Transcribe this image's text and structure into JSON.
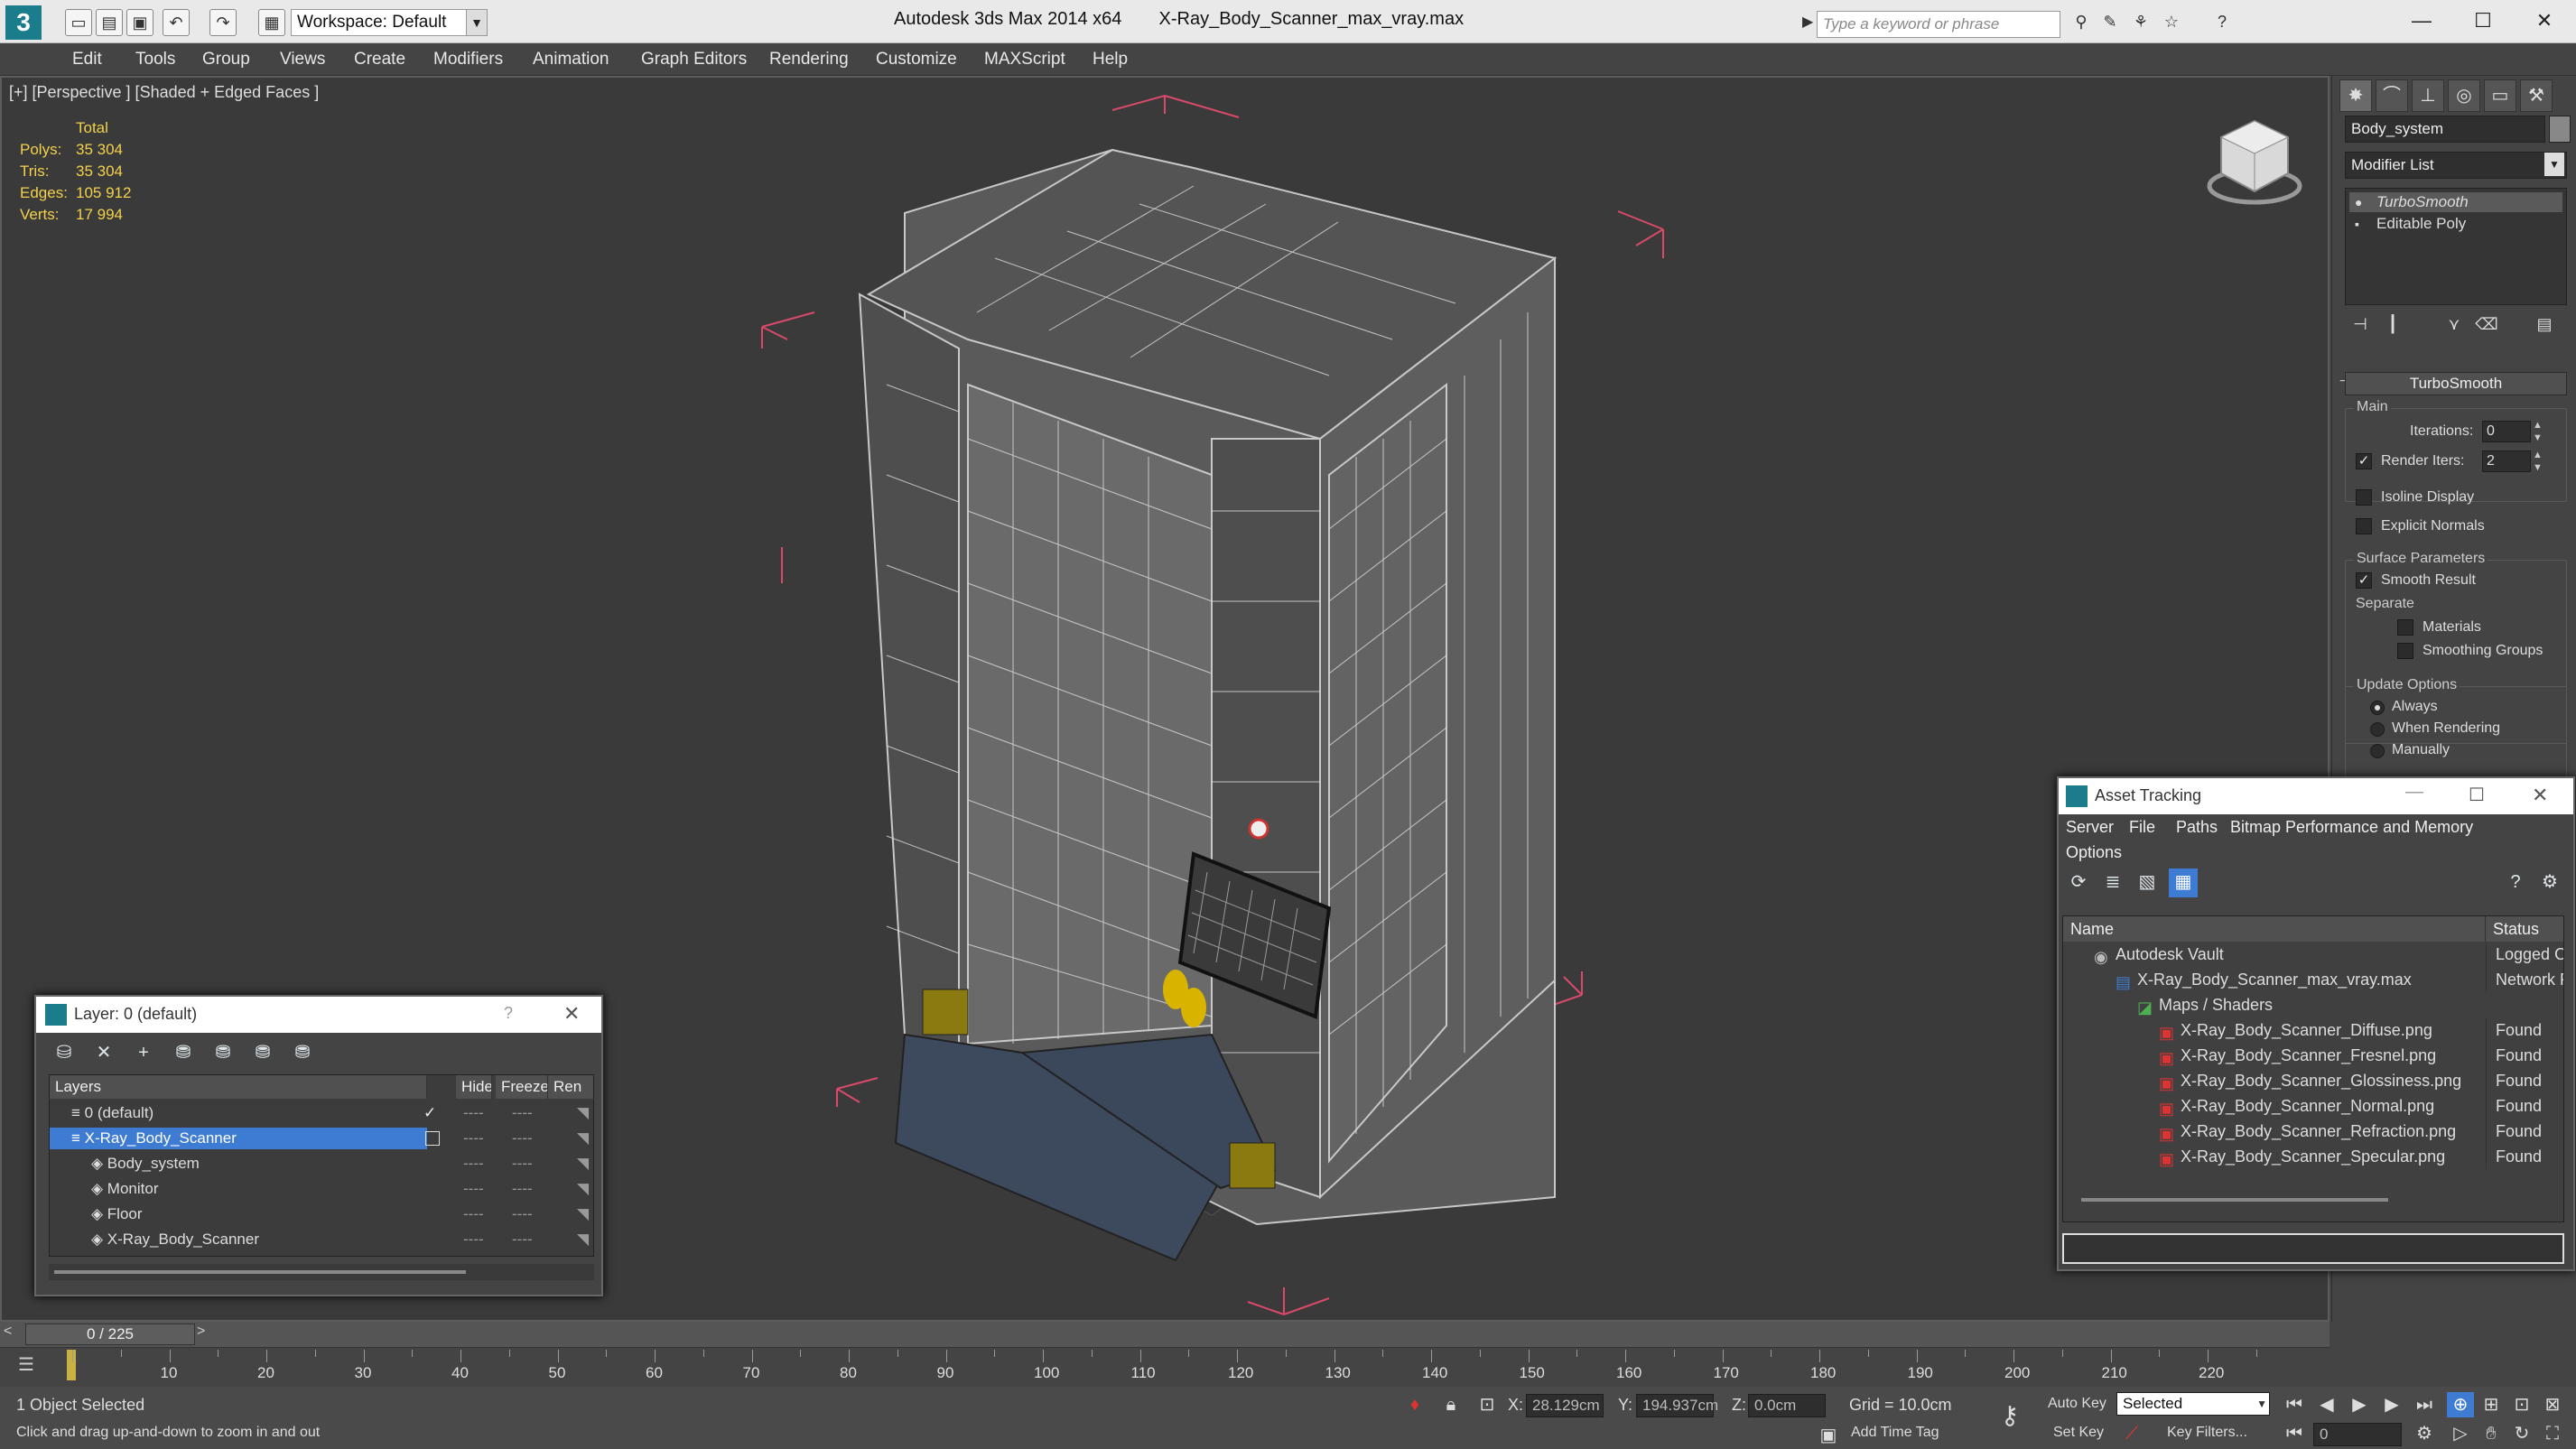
{
  "app": {
    "title": "Autodesk 3ds Max  2014 x64",
    "filename": "X-Ray_Body_Scanner_max_vray.max",
    "workspace": "Workspace: Default",
    "search_placeholder": "Type a keyword or phrase"
  },
  "menu": [
    "Edit",
    "Tools",
    "Group",
    "Views",
    "Create",
    "Modifiers",
    "Animation",
    "Graph Editors",
    "Rendering",
    "Customize",
    "MAXScript",
    "Help"
  ],
  "viewport": {
    "label": "[+] [Perspective ] [Shaded + Edged Faces ]",
    "stats": {
      "header": "Total",
      "rows": [
        {
          "label": "Polys:",
          "value": "35 304"
        },
        {
          "label": "Tris:",
          "value": "35 304"
        },
        {
          "label": "Edges:",
          "value": "105 912"
        },
        {
          "label": "Verts:",
          "value": "17 994"
        }
      ]
    }
  },
  "command_panel": {
    "object_name": "Body_system",
    "modifier_list": "Modifier List",
    "stack": [
      "TurboSmooth",
      "Editable Poly"
    ],
    "rollout": "TurboSmooth",
    "main_group": "Main",
    "iterations_label": "Iterations:",
    "iterations_value": "0",
    "render_iters_label": "Render Iters:",
    "render_iters_value": "2",
    "isoline_display": "Isoline Display",
    "explicit_normals": "Explicit Normals",
    "surface_params": "Surface Parameters",
    "smooth_result": "Smooth Result",
    "separate": "Separate",
    "materials": "Materials",
    "smoothing_groups": "Smoothing Groups",
    "update_options": "Update Options",
    "always": "Always",
    "when_rendering": "When Rendering",
    "manually": "Manually"
  },
  "layer_window": {
    "title": "Layer: 0 (default)",
    "help": "?",
    "columns": [
      "Layers",
      "Hide",
      "Freeze",
      "Ren"
    ],
    "rows": [
      {
        "name": "0 (default)",
        "indent": 1,
        "selected": false,
        "icon": "layer-stack-icon"
      },
      {
        "name": "X-Ray_Body_Scanner",
        "indent": 1,
        "selected": true,
        "icon": "layer-stack-icon"
      },
      {
        "name": "Body_system",
        "indent": 2,
        "selected": false,
        "icon": "object-icon"
      },
      {
        "name": "Monitor",
        "indent": 2,
        "selected": false,
        "icon": "object-icon"
      },
      {
        "name": "Floor",
        "indent": 2,
        "selected": false,
        "icon": "object-icon"
      },
      {
        "name": "X-Ray_Body_Scanner",
        "indent": 2,
        "selected": false,
        "icon": "object-icon"
      }
    ],
    "dash": "----"
  },
  "asset_window": {
    "title": "Asset Tracking",
    "menu": [
      "Server",
      "File",
      "Paths",
      "Bitmap Performance and Memory",
      "Options"
    ],
    "columns": [
      "Name",
      "Status"
    ],
    "rows": [
      {
        "name": "Autodesk Vault",
        "status": "Logged O",
        "indent": 1,
        "icon": "vault-icon"
      },
      {
        "name": "X-Ray_Body_Scanner_max_vray.max",
        "status": "Network F",
        "indent": 2,
        "icon": "max-file-icon"
      },
      {
        "name": "Maps / Shaders",
        "status": "",
        "indent": 3,
        "icon": "maps-icon"
      },
      {
        "name": "X-Ray_Body_Scanner_Diffuse.png",
        "status": "Found",
        "indent": 4,
        "icon": "png-icon"
      },
      {
        "name": "X-Ray_Body_Scanner_Fresnel.png",
        "status": "Found",
        "indent": 4,
        "icon": "png-icon"
      },
      {
        "name": "X-Ray_Body_Scanner_Glossiness.png",
        "status": "Found",
        "indent": 4,
        "icon": "png-icon"
      },
      {
        "name": "X-Ray_Body_Scanner_Normal.png",
        "status": "Found",
        "indent": 4,
        "icon": "png-icon"
      },
      {
        "name": "X-Ray_Body_Scanner_Refraction.png",
        "status": "Found",
        "indent": 4,
        "icon": "png-icon"
      },
      {
        "name": "X-Ray_Body_Scanner_Specular.png",
        "status": "Found",
        "indent": 4,
        "icon": "png-icon"
      }
    ]
  },
  "timeline": {
    "frame_display": "0 / 225",
    "ticks": [
      "10",
      "20",
      "30",
      "40",
      "50",
      "60",
      "70",
      "80",
      "90",
      "100",
      "110",
      "120",
      "130",
      "140",
      "150",
      "160",
      "170",
      "180",
      "190",
      "200",
      "210",
      "220"
    ]
  },
  "status": {
    "selection": "1 Object Selected",
    "prompt": "Click and drag up-and-down to zoom in and out",
    "x_label": "X:",
    "x_value": "28.129cm",
    "y_label": "Y:",
    "y_value": "194.937cm",
    "z_label": "Z:",
    "z_value": "0.0cm",
    "grid": "Grid = 10.0cm",
    "auto_key": "Auto Key",
    "set_key": "Set Key",
    "key_mode": "Selected",
    "key_filters": "Key Filters...",
    "add_time_tag": "Add Time Tag",
    "frame": "0"
  },
  "colors": {
    "accent": "#3e7bd2",
    "stats_yellow": "#f3d14a",
    "bbox_pink": "#d94a6a"
  }
}
